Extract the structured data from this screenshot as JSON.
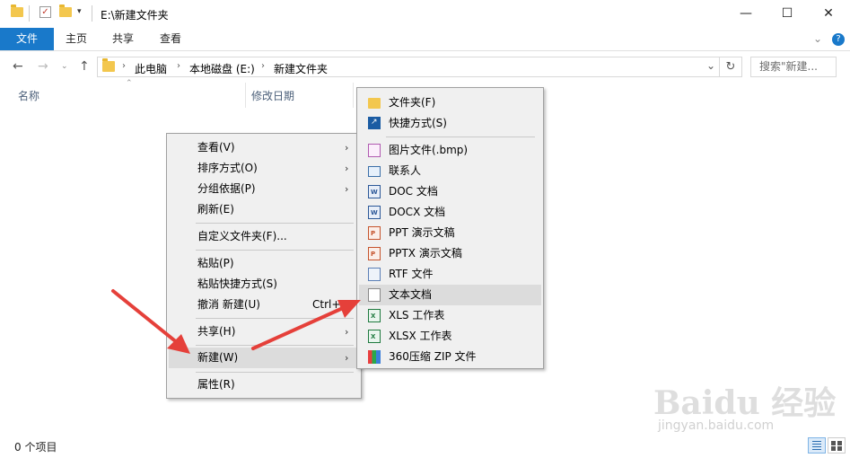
{
  "window": {
    "title": "E:\\新建文件夹",
    "minimize_glyph": "—",
    "maximize_glyph": "☐",
    "close_glyph": "✕"
  },
  "ribbon": {
    "file_tab": "文件",
    "tabs": [
      "主页",
      "共享",
      "查看"
    ],
    "expand_glyph": "⌄",
    "help_glyph": "?"
  },
  "nav": {
    "breadcrumbs": [
      "此电脑",
      "本地磁盘 (E:)",
      "新建文件夹"
    ],
    "search_placeholder": "搜索\"新建...",
    "refresh_glyph": "↻",
    "dropdown_glyph": "⌄"
  },
  "columns": {
    "name": "名称",
    "modified": "修改日期"
  },
  "status": {
    "item_count": "0 个项目"
  },
  "context_menu": {
    "items": {
      "view": "查看(V)",
      "sort": "排序方式(O)",
      "group": "分组依据(P)",
      "refresh": "刷新(E)",
      "customize": "自定义文件夹(F)...",
      "paste": "粘贴(P)",
      "paste_shortcut": "粘贴快捷方式(S)",
      "undo": "撤消 新建(U)",
      "undo_shortcut": "Ctrl+Z",
      "share": "共享(H)",
      "new": "新建(W)",
      "properties": "属性(R)"
    },
    "arrow_glyph": "›"
  },
  "new_submenu": {
    "items": {
      "folder": "文件夹(F)",
      "shortcut": "快捷方式(S)",
      "bmp": "图片文件(.bmp)",
      "contact": "联系人",
      "doc": "DOC 文档",
      "docx": "DOCX 文档",
      "ppt": "PPT 演示文稿",
      "pptx": "PPTX 演示文稿",
      "rtf": "RTF 文件",
      "txt": "文本文档",
      "xls": "XLS 工作表",
      "xlsx": "XLSX 工作表",
      "zip": "360压缩 ZIP 文件"
    }
  },
  "watermark": {
    "logo": "Baidu 经验",
    "url": "jingyan.baidu.com"
  },
  "colors": {
    "accent": "#1979ca",
    "menu_bg": "#f0f0f0",
    "highlight": "#dcdcdc",
    "arrow_red": "#e5403a"
  }
}
